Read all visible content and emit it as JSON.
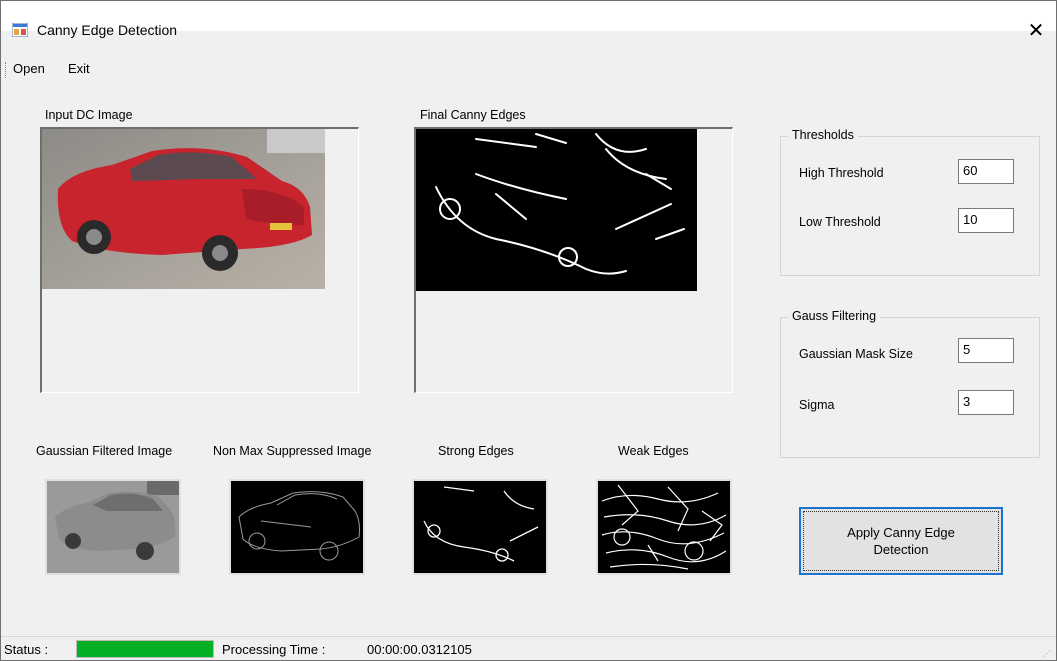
{
  "window": {
    "title": "Canny Edge Detection",
    "close_glyph": "✕",
    "icon": "app-window-icon"
  },
  "menu": {
    "items": [
      {
        "label": "Open"
      },
      {
        "label": "Exit"
      }
    ]
  },
  "panels": {
    "input_label": "Input DC Image",
    "final_label": "Final Canny Edges",
    "gaussian_label": "Gaussian Filtered Image",
    "nonmax_label": "Non Max Suppressed Image",
    "strong_label": "Strong Edges",
    "weak_label": "Weak Edges"
  },
  "thresholds": {
    "title": "Thresholds",
    "high_label": "High Threshold",
    "high_value": "60",
    "low_label": "Low Threshold",
    "low_value": "10"
  },
  "gauss": {
    "title": "Gauss Filtering",
    "mask_label": "Gaussian Mask Size",
    "mask_value": "5",
    "sigma_label": "Sigma",
    "sigma_value": "3"
  },
  "apply_button": {
    "line1": "Apply Canny Edge",
    "line2": "Detection"
  },
  "status": {
    "label": "Status :",
    "progress_fraction": 1.0,
    "progress_color": "#06b025",
    "time_label": "Processing Time :",
    "time_value": "00:00:00.0312105"
  }
}
